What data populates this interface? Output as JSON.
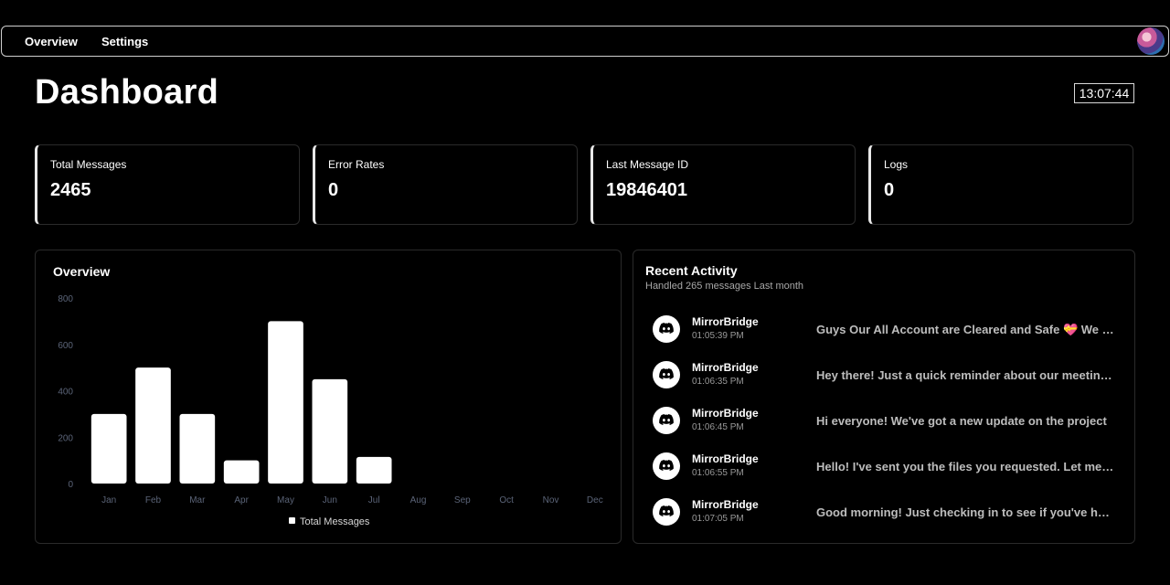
{
  "nav": {
    "overview_label": "Overview",
    "settings_label": "Settings"
  },
  "page": {
    "title": "Dashboard",
    "clock": "13:07:44"
  },
  "stats": [
    {
      "label": "Total Messages",
      "value": "2465"
    },
    {
      "label": "Error Rates",
      "value": "0"
    },
    {
      "label": "Last Message ID",
      "value": "19846401"
    },
    {
      "label": "Logs",
      "value": "0"
    }
  ],
  "overview": {
    "title": "Overview"
  },
  "chart_data": {
    "type": "bar",
    "categories": [
      "Jan",
      "Feb",
      "Mar",
      "Apr",
      "May",
      "Jun",
      "Jul",
      "Aug",
      "Sep",
      "Oct",
      "Nov",
      "Dec"
    ],
    "series": [
      {
        "name": "Total Messages",
        "values": [
          300,
          500,
          300,
          100,
          700,
          450,
          115,
          0,
          0,
          0,
          0,
          0
        ]
      }
    ],
    "yticks": [
      "0",
      "200",
      "400",
      "600",
      "800"
    ],
    "ylim": [
      0,
      800
    ],
    "legend": "bottom",
    "grid": false,
    "colors": {
      "bar": "#ffffff",
      "tick": "#5b6478"
    }
  },
  "activity": {
    "title": "Recent Activity",
    "subtitle": "Handled 265 messages Last month",
    "items": [
      {
        "name": "MirrorBridge",
        "time": "01:05:39 PM",
        "message": "Guys Our All Account are Cleared and Safe 💝 We will be back soon"
      },
      {
        "name": "MirrorBridge",
        "time": "01:06:35 PM",
        "message": "Hey there! Just a quick reminder about our meeting tomorrow"
      },
      {
        "name": "MirrorBridge",
        "time": "01:06:45 PM",
        "message": "Hi everyone! We've got a new update on the project"
      },
      {
        "name": "MirrorBridge",
        "time": "01:06:55 PM",
        "message": "Hello! I've sent you the files you requested. Let me know"
      },
      {
        "name": "MirrorBridge",
        "time": "01:07:05 PM",
        "message": "Good morning! Just checking in to see if you've had a chance"
      }
    ],
    "icon": "discord-icon"
  },
  "theme": {
    "background": "#000000",
    "text": "#ffffff",
    "border": "#2a2a2a",
    "accent": "#e8e8e8"
  }
}
